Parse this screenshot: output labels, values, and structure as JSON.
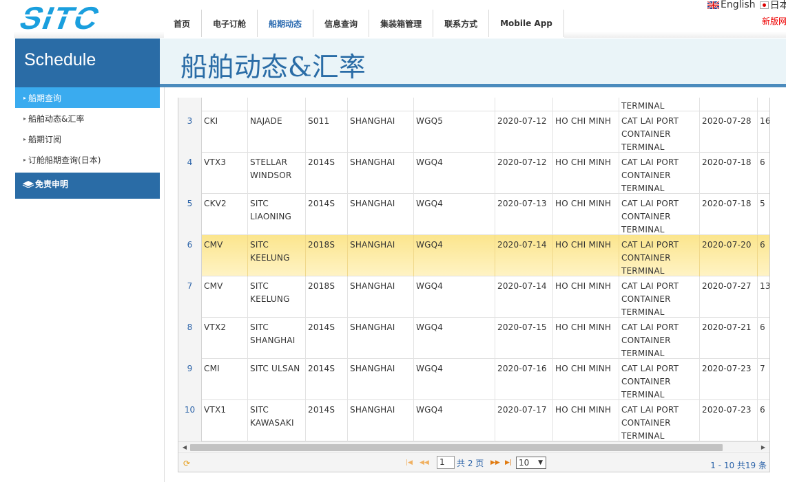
{
  "brand": {
    "logo_text": "SITC",
    "color": "#1a9fde"
  },
  "header": {
    "nav": [
      "首页",
      "电子订舱",
      "船期动态",
      "信息查询",
      "集装箱管理",
      "联系方式",
      "Mobile App"
    ],
    "nav_active": "船期动态",
    "lang_english": "English",
    "lang_japanese": "日本",
    "new_version": "新版网"
  },
  "banner": {
    "left_title": "Schedule",
    "right_title": "船舶动态&汇率"
  },
  "sidebar": {
    "items": [
      "船期查询",
      "船舶动态&汇率",
      "船期订阅",
      "订舱船期查询(日本)"
    ],
    "active_index": 0,
    "disclaimer": "免责申明"
  },
  "grid": {
    "partial_top": {
      "terminal": "TERMINAL"
    },
    "rows": [
      {
        "num": "3",
        "service": "CKI",
        "vessel": "NAJADE",
        "voyage": "S011",
        "pol": "SHANGHAI",
        "terminal": "WGQ5",
        "etd": "2020-07-12",
        "pod": "HO CHI MINH",
        "pod_terminal": "CAT LAI PORT CONTAINER TERMINAL",
        "eta": "2020-07-28",
        "days": "16",
        "selected": false
      },
      {
        "num": "4",
        "service": "VTX3",
        "vessel": "STELLAR WINDSOR",
        "voyage": "2014S",
        "pol": "SHANGHAI",
        "terminal": "WGQ4",
        "etd": "2020-07-12",
        "pod": "HO CHI MINH",
        "pod_terminal": "CAT LAI PORT CONTAINER TERMINAL",
        "eta": "2020-07-18",
        "days": "6",
        "selected": false
      },
      {
        "num": "5",
        "service": "CKV2",
        "vessel": "SITC LIAONING",
        "voyage": "2014S",
        "pol": "SHANGHAI",
        "terminal": "WGQ4",
        "etd": "2020-07-13",
        "pod": "HO CHI MINH",
        "pod_terminal": "CAT LAI PORT CONTAINER TERMINAL",
        "eta": "2020-07-18",
        "days": "5",
        "selected": false
      },
      {
        "num": "6",
        "service": "CMV",
        "vessel": "SITC KEELUNG",
        "voyage": "2018S",
        "pol": "SHANGHAI",
        "terminal": "WGQ4",
        "etd": "2020-07-14",
        "pod": "HO CHI MINH",
        "pod_terminal": "CAT LAI PORT CONTAINER TERMINAL",
        "eta": "2020-07-20",
        "days": "6",
        "selected": true
      },
      {
        "num": "7",
        "service": "CMV",
        "vessel": "SITC KEELUNG",
        "voyage": "2018S",
        "pol": "SHANGHAI",
        "terminal": "WGQ4",
        "etd": "2020-07-14",
        "pod": "HO CHI MINH",
        "pod_terminal": "CAT LAI PORT CONTAINER TERMINAL",
        "eta": "2020-07-27",
        "days": "13",
        "selected": false
      },
      {
        "num": "8",
        "service": "VTX2",
        "vessel": "SITC SHANGHAI",
        "voyage": "2014S",
        "pol": "SHANGHAI",
        "terminal": "WGQ4",
        "etd": "2020-07-15",
        "pod": "HO CHI MINH",
        "pod_terminal": "CAT LAI PORT CONTAINER TERMINAL",
        "eta": "2020-07-21",
        "days": "6",
        "selected": false
      },
      {
        "num": "9",
        "service": "CMI",
        "vessel": "SITC ULSAN",
        "voyage": "2014S",
        "pol": "SHANGHAI",
        "terminal": "WGQ4",
        "etd": "2020-07-16",
        "pod": "HO CHI MINH",
        "pod_terminal": "CAT LAI PORT CONTAINER TERMINAL",
        "eta": "2020-07-23",
        "days": "7",
        "selected": false
      },
      {
        "num": "10",
        "service": "VTX1",
        "vessel": "SITC KAWASAKI",
        "voyage": "2014S",
        "pol": "SHANGHAI",
        "terminal": "WGQ4",
        "etd": "2020-07-17",
        "pod": "HO CHI MINH",
        "pod_terminal": "CAT LAI PORT CONTAINER TERMINAL",
        "eta": "2020-07-23",
        "days": "6",
        "selected": false
      }
    ]
  },
  "pager": {
    "page": "1",
    "total_pages": "共 2 页",
    "page_size": "10",
    "info": "1 - 10  共19 条"
  },
  "icons": {
    "refresh": "refresh-icon",
    "first": "first-page-icon",
    "prev": "prev-page-icon",
    "next": "next-page-icon",
    "last": "last-page-icon",
    "scroll_left": "scroll-left-icon",
    "scroll_right": "scroll-right-icon"
  },
  "colors": {
    "primary_blue": "#2a6ca6",
    "active_sidebar": "#3aabef",
    "banner_bg": "#eaf4f8",
    "selected_row": "#fbe58d",
    "link_blue": "#2a62a8",
    "red": "#e00000"
  }
}
